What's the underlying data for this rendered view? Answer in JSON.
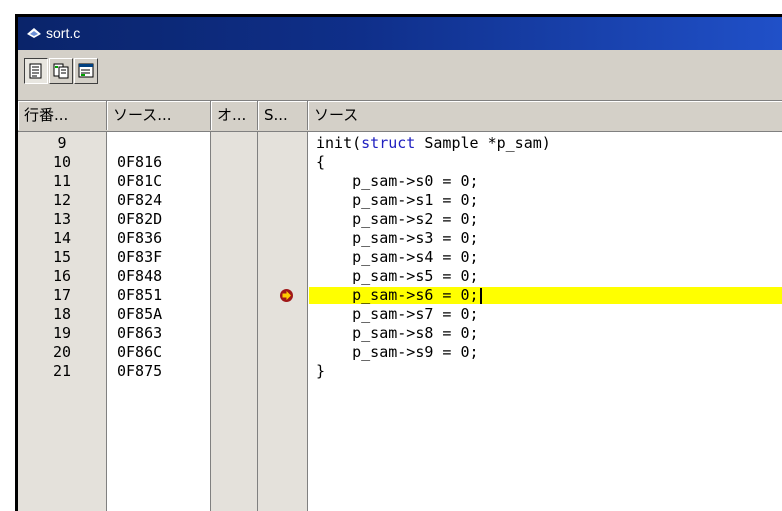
{
  "window": {
    "title": "sort.c",
    "icon": "source-file-icon"
  },
  "toolbar": {
    "buttons": [
      {
        "name": "source-view-icon"
      },
      {
        "name": "mixed-view-icon"
      },
      {
        "name": "disassembly-view-icon"
      }
    ]
  },
  "columns": [
    "行番...",
    "ソース...",
    "オ...",
    "S...",
    "ソース"
  ],
  "rows": [
    {
      "line": "9",
      "address": "",
      "source": "init(struct Sample *p_sam)",
      "highlight": false,
      "marker": false
    },
    {
      "line": "10",
      "address": "0F816",
      "source": "{",
      "highlight": false,
      "marker": false
    },
    {
      "line": "11",
      "address": "0F81C",
      "source": "    p_sam->s0 = 0;",
      "highlight": false,
      "marker": false
    },
    {
      "line": "12",
      "address": "0F824",
      "source": "    p_sam->s1 = 0;",
      "highlight": false,
      "marker": false
    },
    {
      "line": "13",
      "address": "0F82D",
      "source": "    p_sam->s2 = 0;",
      "highlight": false,
      "marker": false
    },
    {
      "line": "14",
      "address": "0F836",
      "source": "    p_sam->s3 = 0;",
      "highlight": false,
      "marker": false
    },
    {
      "line": "15",
      "address": "0F83F",
      "source": "    p_sam->s4 = 0;",
      "highlight": false,
      "marker": false
    },
    {
      "line": "16",
      "address": "0F848",
      "source": "    p_sam->s5 = 0;",
      "highlight": false,
      "marker": false
    },
    {
      "line": "17",
      "address": "0F851",
      "source": "    p_sam->s6 = 0;",
      "highlight": true,
      "marker": true
    },
    {
      "line": "18",
      "address": "0F85A",
      "source": "    p_sam->s7 = 0;",
      "highlight": false,
      "marker": false
    },
    {
      "line": "19",
      "address": "0F863",
      "source": "    p_sam->s8 = 0;",
      "highlight": false,
      "marker": false
    },
    {
      "line": "20",
      "address": "0F86C",
      "source": "    p_sam->s9 = 0;",
      "highlight": false,
      "marker": false
    },
    {
      "line": "21",
      "address": "0F875",
      "source": "}",
      "highlight": false,
      "marker": false
    }
  ],
  "colors": {
    "highlight": "#ffff00",
    "marker": "#ffcc00",
    "keyword": "#2020c0",
    "title_bar": "#0a246a"
  }
}
